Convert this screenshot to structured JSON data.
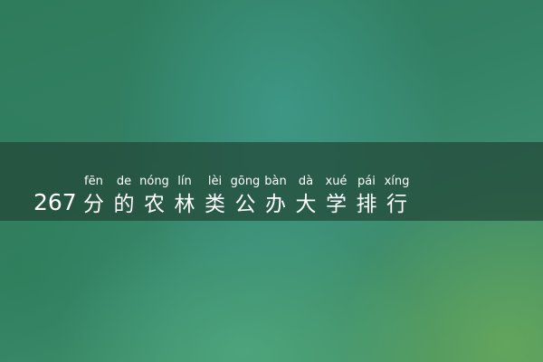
{
  "title": {
    "number": "267",
    "chars": [
      {
        "py": "fēn",
        "hz": "分"
      },
      {
        "py": "de",
        "hz": "的"
      },
      {
        "py": "nóng",
        "hz": "农"
      },
      {
        "py": "lín",
        "hz": "林"
      },
      {
        "py": "lèi",
        "hz": "类"
      },
      {
        "py": "gōng",
        "hz": "公"
      },
      {
        "py": "bàn",
        "hz": "办"
      },
      {
        "py": "dà",
        "hz": "大"
      },
      {
        "py": "xué",
        "hz": "学"
      },
      {
        "py": "pái",
        "hz": "排"
      },
      {
        "py": "xíng",
        "hz": "行"
      }
    ]
  },
  "colors": {
    "banner": "#234637",
    "text": "#ffffff"
  }
}
